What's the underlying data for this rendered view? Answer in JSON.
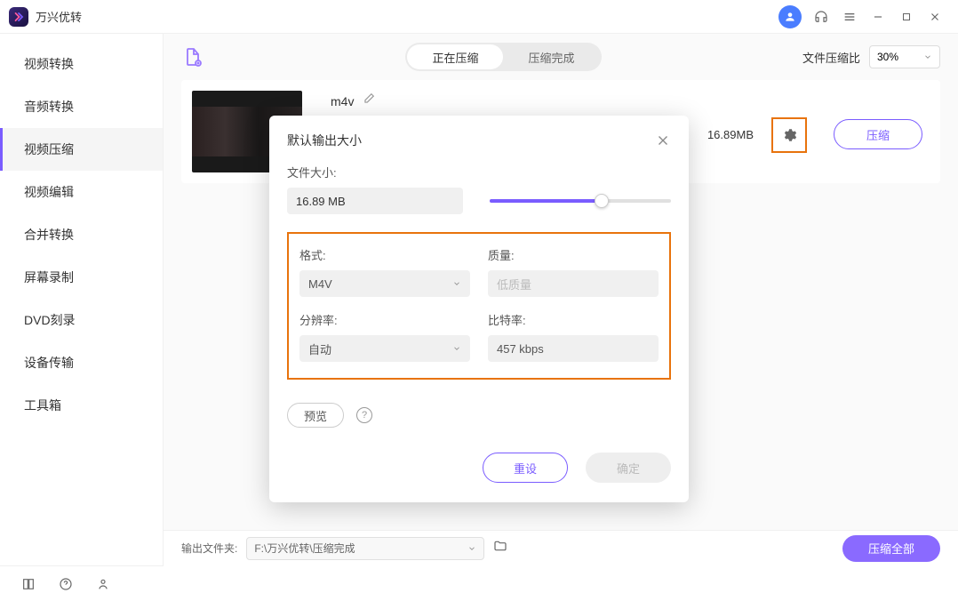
{
  "app": {
    "title": "万兴优转"
  },
  "sidebar": {
    "items": [
      {
        "label": "视频转换"
      },
      {
        "label": "音频转换"
      },
      {
        "label": "视频压缩"
      },
      {
        "label": "视频编辑"
      },
      {
        "label": "合并转换"
      },
      {
        "label": "屏幕录制"
      },
      {
        "label": "DVD刻录"
      },
      {
        "label": "设备传输"
      },
      {
        "label": "工具箱"
      }
    ],
    "active_index": 2
  },
  "tabs": {
    "a": "正在压缩",
    "b": "压缩完成",
    "active": 0
  },
  "ratio": {
    "label": "文件压缩比",
    "value": "30%"
  },
  "file": {
    "name": "m4v",
    "size": "16.89MB",
    "compress_label": "压缩"
  },
  "dialog": {
    "title": "默认输出大小",
    "filesize_label": "文件大小:",
    "filesize_value": "16.89 MB",
    "slider_percent": 62,
    "format_label": "格式:",
    "format_value": "M4V",
    "quality_label": "质量:",
    "quality_value": "低质量",
    "resolution_label": "分辨率:",
    "resolution_value": "自动",
    "bitrate_label": "比特率:",
    "bitrate_value": "457 kbps",
    "preview_label": "预览",
    "reset_label": "重设",
    "confirm_label": "确定"
  },
  "footer": {
    "output_label": "输出文件夹:",
    "output_path": "F:\\万兴优转\\压缩完成",
    "compress_all": "压缩全部"
  }
}
